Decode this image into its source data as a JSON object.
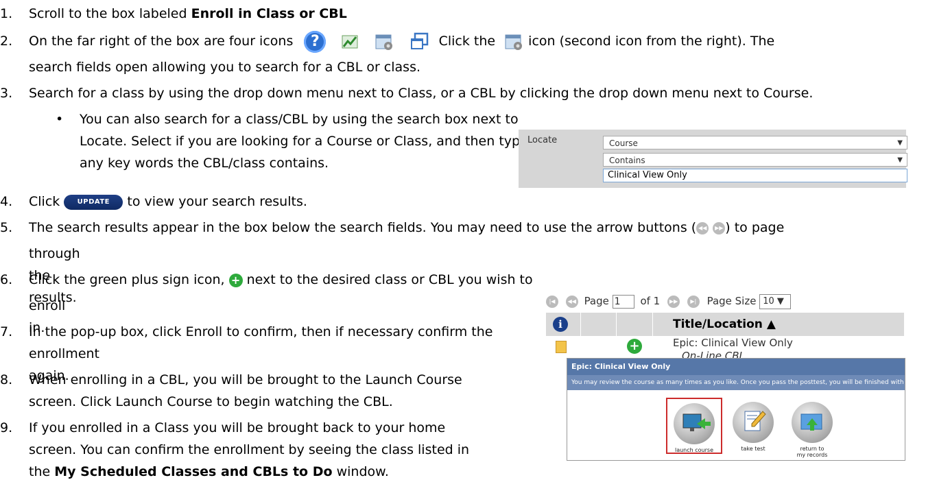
{
  "steps": {
    "s1": {
      "num": "1.",
      "pre": "Scroll to the box labeled ",
      "bold": "Enroll in Class or CBL"
    },
    "s2": {
      "num": "2.",
      "pre": "On the far right of the box are four icons",
      "mid": "Click the",
      "post": "icon (second icon from the right). The",
      "line2": "search fields open allowing you to search for a CBL or class."
    },
    "s3": {
      "num": "3.",
      "text": "Search for a class by using the drop down menu next to Class, or a CBL by clicking the drop down menu next to Course."
    },
    "bullet": {
      "l1": "You can also search for a class/CBL by using the search box next to",
      "l2": "Locate. Select if you are looking for a Course or Class, and then type",
      "l3": "any key words the CBL/class contains."
    },
    "s4": {
      "num": "4.",
      "pre": "Click",
      "post": "to view your search results."
    },
    "s5": {
      "num": "5.",
      "l1a": "The search results appear in the box below the search fields. You may need to use the arrow buttons (",
      "l1b": ") to page",
      "l2": "through the results."
    },
    "s6": {
      "num": "6.",
      "l1a": "Click the green plus sign icon,",
      "l1b": "next to the desired class or CBL you wish to",
      "l2": "enroll in."
    },
    "s7": {
      "num": "7.",
      "l1": "In the pop-up box, click Enroll to confirm, then if necessary confirm the",
      "l2": "enrollment again."
    },
    "s8": {
      "num": "8.",
      "l1": "When enrolling in a CBL, you will be brought to the Launch Course",
      "l2": "screen. Click Launch Course to begin watching the CBL."
    },
    "s9": {
      "num": "9.",
      "l1": "If you enrolled in a Class you will be brought back to your home",
      "l2": "screen. You can confirm the enrollment by seeing the class listed in",
      "l3pre": "the ",
      "l3bold": "My Scheduled Classes and CBLs to Do",
      "l3post": " window."
    }
  },
  "icons": {
    "help_glyph": "?",
    "update_label": "UPDATE"
  },
  "locate": {
    "label": "Locate",
    "field_select": "Course",
    "operator_select": "Contains",
    "search_value": "Clinical View Only"
  },
  "pager": {
    "page_label": "Page",
    "page_value": "1",
    "of_label": "of 1",
    "size_label": "Page Size",
    "size_value": "10"
  },
  "results": {
    "info_glyph": "i",
    "title_header": "Title/Location ▲",
    "row_title": "Epic: Clinical View Only",
    "row_location": "On-Line CBL"
  },
  "launch": {
    "title": "Epic: Clinical View Only",
    "desc": "You may review the course as many times as you like. Once you pass the posttest, you will be finished with this course.",
    "btn1": "launch course",
    "btn2": "take test",
    "btn3a": "return to",
    "btn3b": "my records"
  }
}
